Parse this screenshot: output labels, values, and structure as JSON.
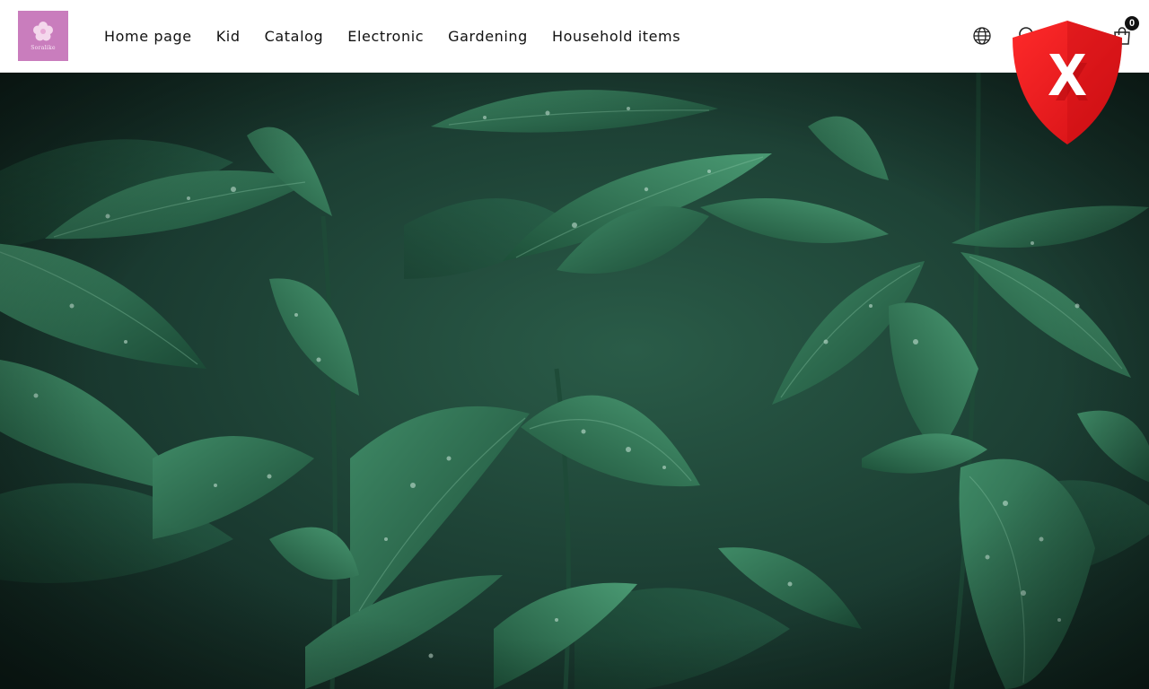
{
  "brand": {
    "logo_text": "Soralike",
    "logo_color": "#c97dbd"
  },
  "nav": {
    "items": [
      {
        "label": "Home page"
      },
      {
        "label": "Kid"
      },
      {
        "label": "Catalog"
      },
      {
        "label": "Electronic"
      },
      {
        "label": "Gardening"
      },
      {
        "label": "Household items"
      }
    ]
  },
  "header_icons": {
    "language": "globe-icon",
    "search": "search-icon",
    "cart": "shopping-bag-icon",
    "cart_count": "0"
  },
  "hero": {
    "image": "dark green leaves with water droplets"
  },
  "overlay": {
    "icon": "red-shield-x-icon",
    "color": "#e8141a"
  }
}
